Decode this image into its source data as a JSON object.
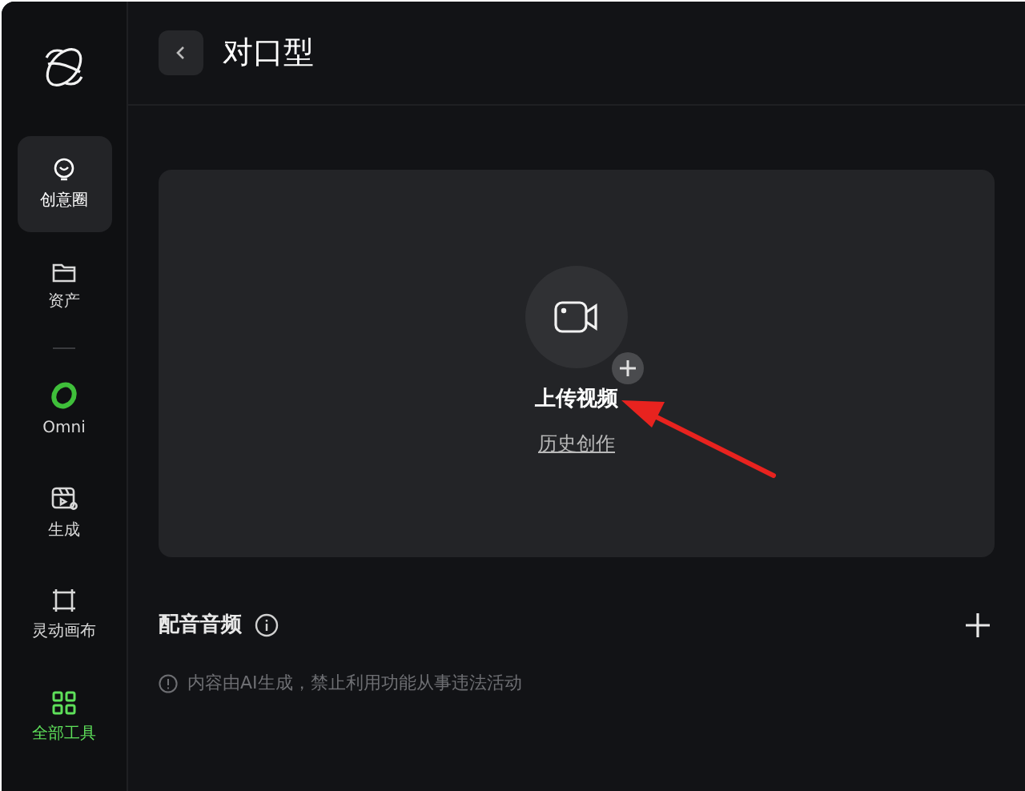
{
  "sidebar": {
    "items": [
      {
        "label": "创意圈",
        "selected": true,
        "active": false
      },
      {
        "label": "资产",
        "selected": false,
        "active": false
      },
      {
        "kind": "divider"
      },
      {
        "label": "Omni",
        "selected": false,
        "active": false
      },
      {
        "label": "生成",
        "selected": false,
        "active": false
      },
      {
        "label": "灵动画布",
        "selected": false,
        "active": false
      },
      {
        "label": "全部工具",
        "selected": false,
        "active": true
      }
    ]
  },
  "header": {
    "title": "对口型"
  },
  "upload": {
    "label": "上传视频",
    "link": "历史创作"
  },
  "audio_section": {
    "title": "配音音频"
  },
  "notice": "内容由AI生成，禁止利用功能从事违法活动"
}
